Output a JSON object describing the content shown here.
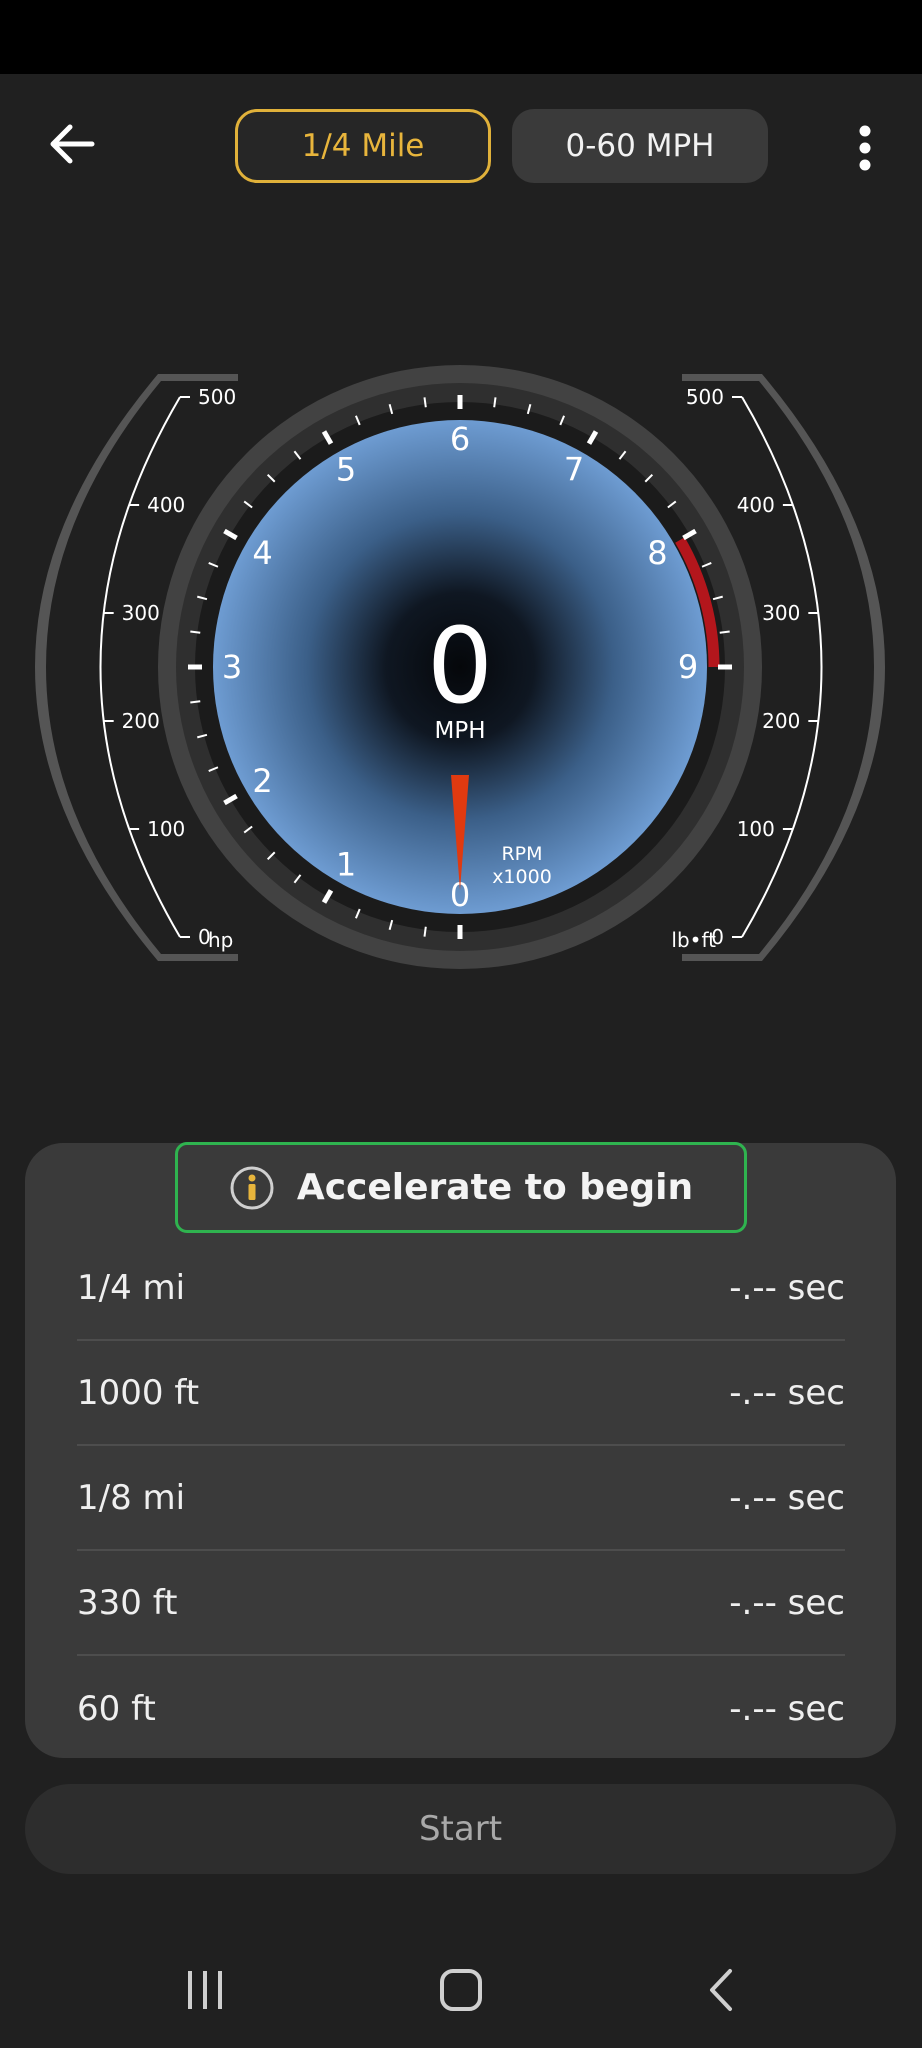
{
  "header": {
    "tabs": [
      {
        "label": "1/4 Mile",
        "active": true
      },
      {
        "label": "0-60 MPH",
        "active": false
      }
    ],
    "back_icon": "arrow-left-icon",
    "more_icon": "more-vertical-icon"
  },
  "gauge": {
    "speed_value": "0",
    "speed_unit": "MPH",
    "rpm_label": "RPM",
    "rpm_multiplier": "x1000",
    "rpm_ticks": [
      "0",
      "1",
      "2",
      "3",
      "4",
      "5",
      "6",
      "7",
      "8",
      "9"
    ],
    "rpm_needle_value": 0,
    "redline_from": 8,
    "redline_to": 9,
    "left_scale": {
      "unit": "hp",
      "ticks": [
        "0",
        "100",
        "200",
        "300",
        "400",
        "500"
      ],
      "value": 0
    },
    "right_scale": {
      "unit": "lb•ft",
      "ticks": [
        "0",
        "100",
        "200",
        "300",
        "400",
        "500"
      ],
      "value": 0
    }
  },
  "results": {
    "banner_text": "Accelerate to begin",
    "banner_icon": "info-icon",
    "rows": [
      {
        "label": "1/4 mi",
        "value": "-.-- sec"
      },
      {
        "label": "1000 ft",
        "value": "-.-- sec"
      },
      {
        "label": "1/8 mi",
        "value": "-.-- sec"
      },
      {
        "label": "330 ft",
        "value": "-.-- sec"
      },
      {
        "label": "60 ft",
        "value": "-.-- sec"
      }
    ]
  },
  "start_label": "Start",
  "nav": {
    "recents_icon": "recents-icon",
    "home_icon": "home-icon",
    "back_icon": "nav-back-icon"
  },
  "colors": {
    "accent": "#e8b53c",
    "banner_border": "#2fb34f",
    "needle": "#e03a10",
    "redline": "#b3161c",
    "dial_blue": "#6a9ad0"
  }
}
